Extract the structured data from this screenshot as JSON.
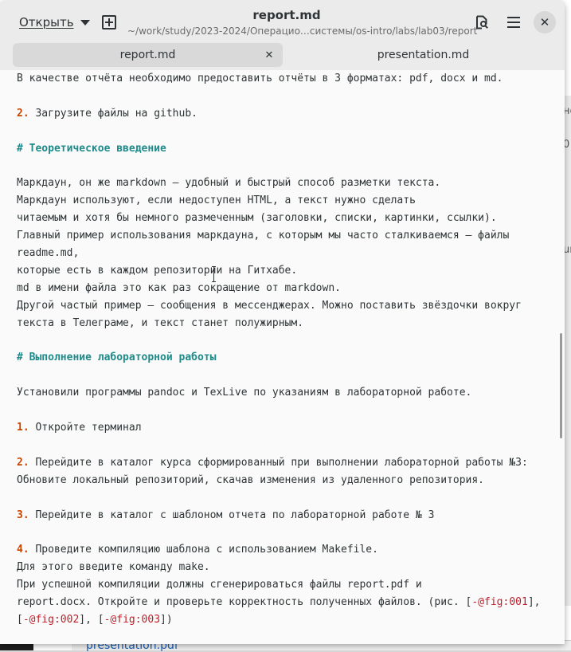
{
  "window": {
    "title": "report.md",
    "path": "~/work/study/2023-2024/Операцио…системы/os-intro/labs/lab03/report"
  },
  "header": {
    "open_label": "Открыть"
  },
  "tabs": [
    {
      "label": "report.md",
      "active": true
    },
    {
      "label": "presentation.md",
      "active": false
    }
  ],
  "background": {
    "bottom_link": "presentation.pdf",
    "right_frags": [
      "не",
      "0",
      "ur"
    ]
  },
  "editor": {
    "lines": [
      {
        "parts": [
          {
            "t": "В качестве отчёта необходимо предоставить отчёты в 3 форматах: pdf, docx и md.",
            "k": "text"
          }
        ]
      },
      {
        "parts": []
      },
      {
        "parts": [
          {
            "t": "2.",
            "k": "num"
          },
          {
            "t": " Загрузите файлы на github.",
            "k": "text"
          }
        ]
      },
      {
        "parts": []
      },
      {
        "parts": [
          {
            "t": "# Теоретическое введение",
            "k": "heading"
          }
        ]
      },
      {
        "parts": []
      },
      {
        "parts": [
          {
            "t": "Маркдаун, он же markdown — удобный и быстрый способ разметки текста.",
            "k": "text"
          }
        ]
      },
      {
        "parts": [
          {
            "t": "Маркдаун используют, если недоступен HTML, а текст нужно сделать",
            "k": "text"
          }
        ]
      },
      {
        "parts": [
          {
            "t": "читаемым и хотя бы немного размеченным (заголовки, списки, картинки, ссылки).",
            "k": "text"
          }
        ]
      },
      {
        "parts": [
          {
            "t": "Главный пример использования маркдауна, с которым мы часто сталкиваемся — файлы",
            "k": "text"
          }
        ]
      },
      {
        "parts": [
          {
            "t": "readme.md,",
            "k": "text"
          }
        ]
      },
      {
        "parts": [
          {
            "t": "которые есть в каждом репозитории на Гитхабе.",
            "k": "text"
          }
        ]
      },
      {
        "parts": [
          {
            "t": "md в имени файла это как раз сокращение от markdown.",
            "k": "text"
          }
        ]
      },
      {
        "parts": [
          {
            "t": "Другой частый пример — сообщения в мессенджерах. Можно поставить звёздочки вокруг",
            "k": "text"
          }
        ]
      },
      {
        "parts": [
          {
            "t": "текста в Телеграме, и текст станет полужирным.",
            "k": "text"
          }
        ]
      },
      {
        "parts": []
      },
      {
        "parts": [
          {
            "t": "# Выполнение лабораторной работы",
            "k": "heading"
          }
        ]
      },
      {
        "parts": []
      },
      {
        "parts": [
          {
            "t": "Установили программы pandoc и TexLive по указаниям в лабораторной работе.",
            "k": "text"
          }
        ]
      },
      {
        "parts": []
      },
      {
        "parts": [
          {
            "t": "1.",
            "k": "num"
          },
          {
            "t": " Откройте терминал",
            "k": "text"
          }
        ]
      },
      {
        "parts": []
      },
      {
        "parts": [
          {
            "t": "2.",
            "k": "num"
          },
          {
            "t": " Перейдите в каталог курса сформированный при выполнении лабораторной работы №3:",
            "k": "text"
          }
        ]
      },
      {
        "parts": [
          {
            "t": "Обновите локальный репозиторий, скачав изменения из удаленного репозитория.",
            "k": "text"
          }
        ]
      },
      {
        "parts": []
      },
      {
        "parts": [
          {
            "t": "3.",
            "k": "num"
          },
          {
            "t": " Перейдите в каталог с шаблоном отчета по лабораторной работе № 3",
            "k": "text"
          }
        ]
      },
      {
        "parts": []
      },
      {
        "parts": [
          {
            "t": "4.",
            "k": "num"
          },
          {
            "t": " Проведите компиляцию шаблона с использованием Makefile.",
            "k": "text"
          }
        ]
      },
      {
        "parts": [
          {
            "t": "Для этого введите команду make.",
            "k": "text"
          }
        ]
      },
      {
        "parts": [
          {
            "t": "При успешной компиляции должны сгенерироваться файлы report.pdf и",
            "k": "text"
          }
        ]
      },
      {
        "parts": [
          {
            "t": "report.docx. Откройте и проверьте корректность полученных файлов. (рис. [",
            "k": "text"
          },
          {
            "t": "-@fig:001",
            "k": "ref"
          },
          {
            "t": "],",
            "k": "text"
          }
        ]
      },
      {
        "parts": [
          {
            "t": "[",
            "k": "text"
          },
          {
            "t": "-@fig:002",
            "k": "ref"
          },
          {
            "t": "], [",
            "k": "text"
          },
          {
            "t": "-@fig:003",
            "k": "ref"
          },
          {
            "t": "])",
            "k": "text"
          }
        ]
      }
    ]
  }
}
